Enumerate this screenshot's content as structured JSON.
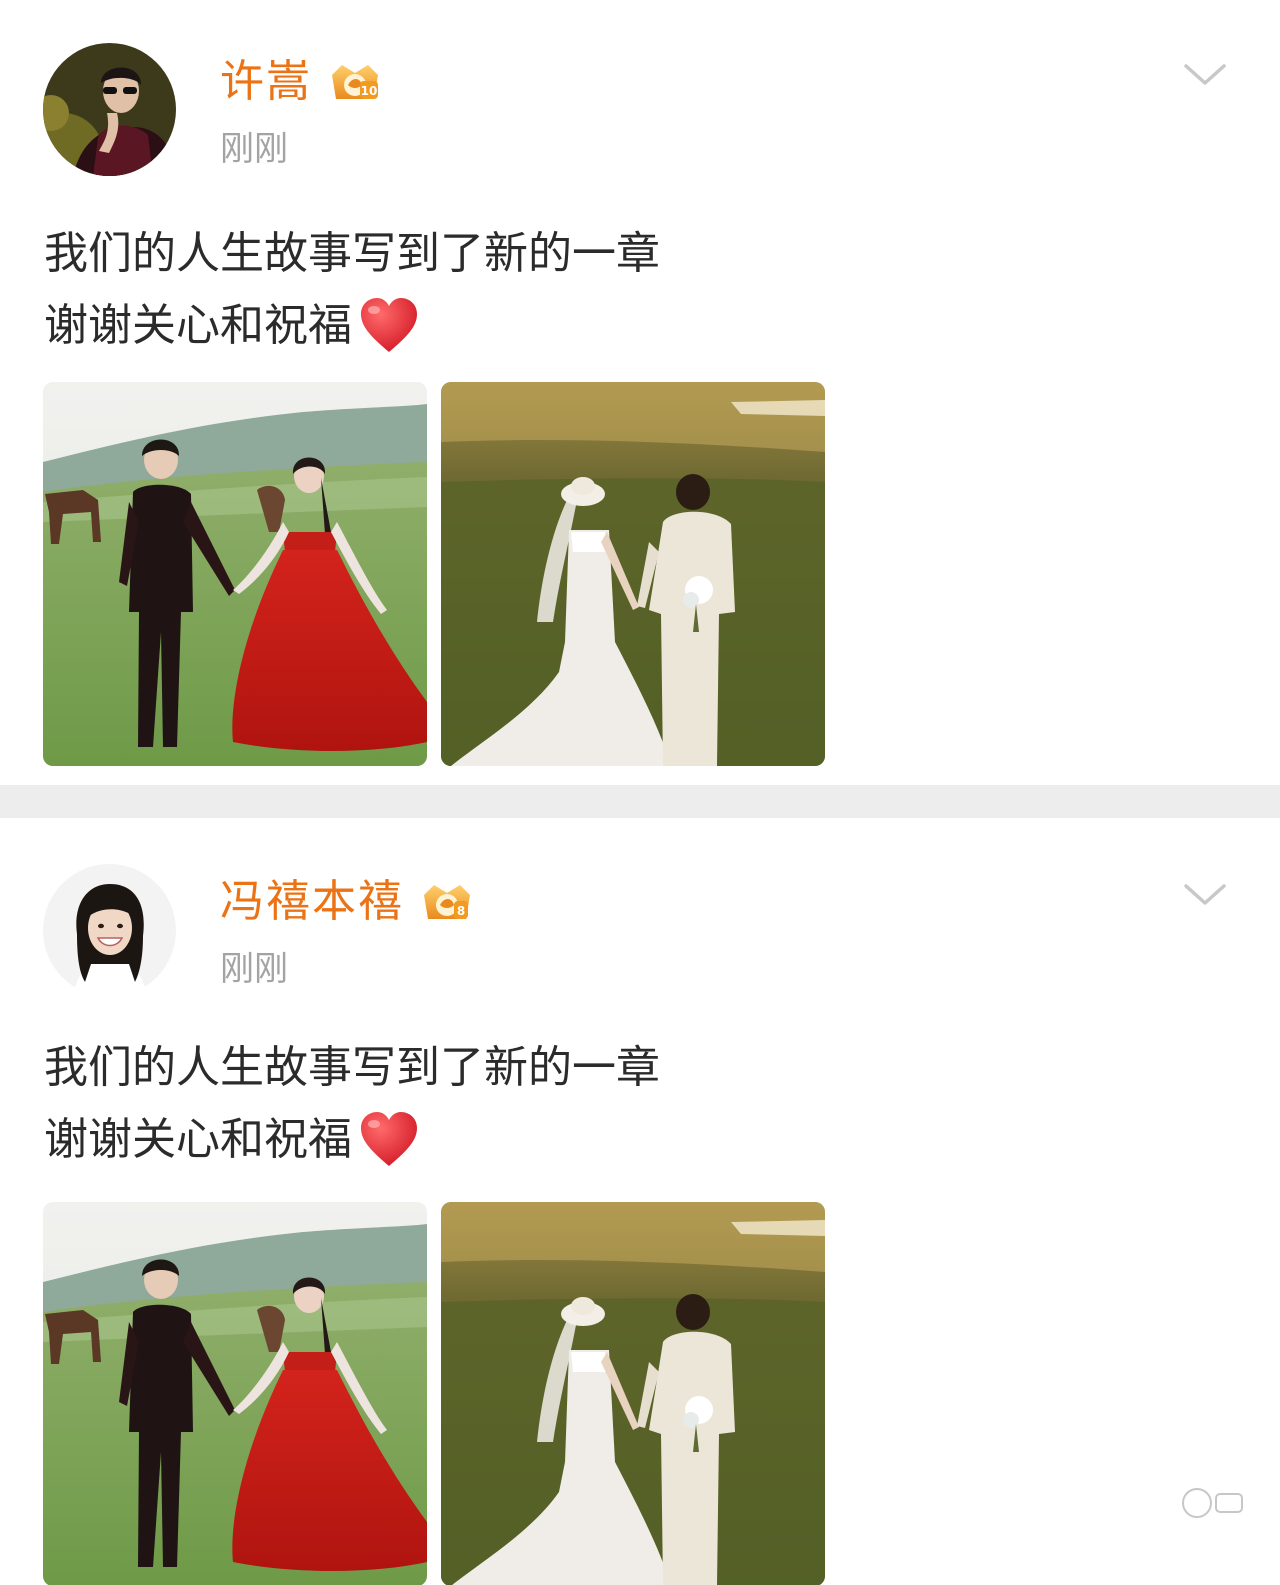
{
  "posts": [
    {
      "username": "许嵩",
      "vip_level": "10",
      "timestamp": "刚刚",
      "content_line1": "我们的人生故事写到了新的一章",
      "content_line2": "谢谢关心和祝福",
      "avatar_icon": "man-sunglasses-avatar-icon",
      "images": [
        "couple-red-dress-grassland-photo",
        "couple-white-wedding-sunset-photo"
      ]
    },
    {
      "username": "冯禧本禧",
      "vip_level": "8",
      "timestamp": "刚刚",
      "content_line1": "我们的人生故事写到了新的一章",
      "content_line2": "谢谢关心和祝福",
      "avatar_icon": "smiling-woman-avatar-icon",
      "images": [
        "couple-red-dress-grassland-photo",
        "couple-white-wedding-sunset-photo"
      ]
    }
  ],
  "colors": {
    "username": "#eb7316",
    "timestamp": "#a3a3a3",
    "content": "#2b2b2b",
    "separator": "#ededed",
    "heart": "#e0212f"
  },
  "icons": {
    "more": "chevron-down-icon",
    "heart": "red-heart-emoji-icon",
    "badge": "vip-crown-badge-icon"
  }
}
